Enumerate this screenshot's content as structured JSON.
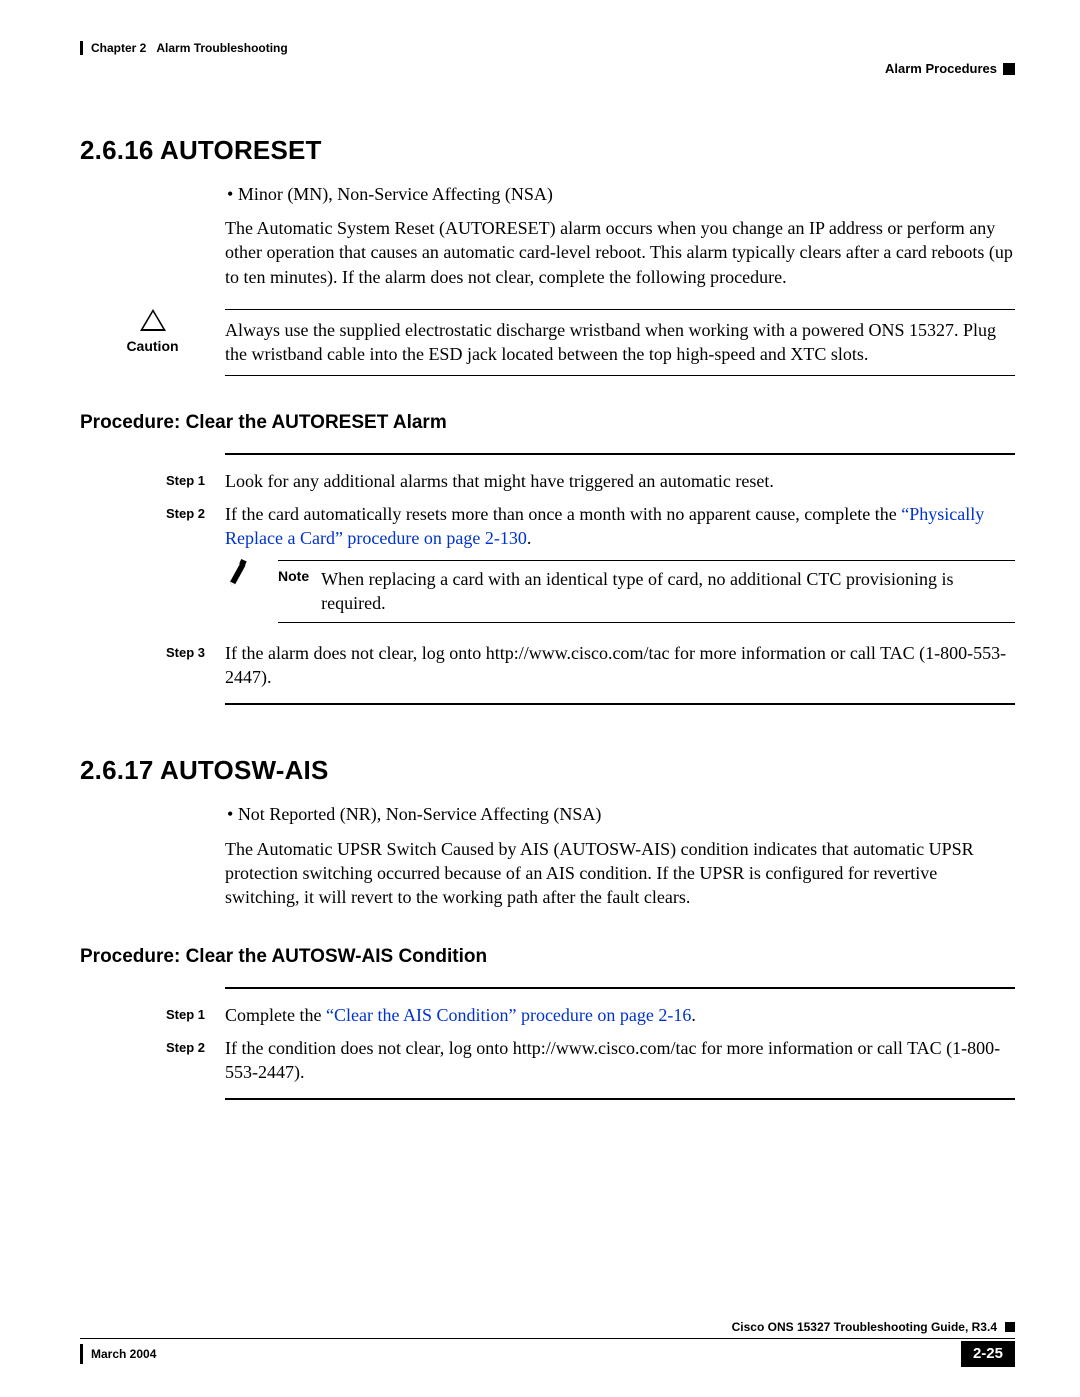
{
  "header": {
    "chapter": "Chapter 2",
    "title": "Alarm Troubleshooting",
    "section": "Alarm Procedures"
  },
  "sections": [
    {
      "number": "2.6.16",
      "title": "AUTORESET",
      "bullet": "Minor (MN), Non-Service Affecting (NSA)",
      "intro": "The Automatic System Reset (AUTORESET) alarm occurs when you change an IP address or perform any other operation that causes an automatic card-level reboot. This alarm typically clears after a card reboots (up to ten minutes). If the alarm does not clear, complete the following procedure.",
      "caution_label": "Caution",
      "caution": "Always use the supplied electrostatic discharge wristband when working with a powered ONS 15327. Plug the wristband cable into the ESD jack located between the top high-speed and XTC slots.",
      "procedure_title": "Procedure: Clear the AUTORESET Alarm",
      "steps": [
        {
          "label": "Step 1",
          "text": "Look for any additional alarms that might have triggered an automatic reset."
        },
        {
          "label": "Step 2",
          "text_before": "If the card automatically resets more than once a month with no apparent cause, complete the ",
          "link": "“Physically Replace a Card” procedure on page 2-130",
          "text_after": "."
        },
        {
          "label": "Step 3",
          "text": "If the alarm does not clear, log onto http://www.cisco.com/tac for more information or call TAC (1-800-553-2447)."
        }
      ],
      "note_label": "Note",
      "note": "When replacing a card with an identical type of card, no additional CTC provisioning is required."
    },
    {
      "number": "2.6.17",
      "title": "AUTOSW-AIS",
      "bullet": "Not Reported (NR), Non-Service Affecting (NSA)",
      "intro": "The Automatic UPSR Switch Caused by AIS (AUTOSW-AIS) condition indicates that automatic UPSR protection switching occurred because of an AIS condition. If the UPSR is configured for revertive switching, it will revert to the working path after the fault clears.",
      "procedure_title": "Procedure: Clear the AUTOSW-AIS Condition",
      "steps": [
        {
          "label": "Step 1",
          "text_before": "Complete the ",
          "link": "“Clear the AIS Condition” procedure on page 2-16",
          "text_after": "."
        },
        {
          "label": "Step 2",
          "text": "If the condition does not clear, log onto http://www.cisco.com/tac for more information or call TAC (1-800-553-2447)."
        }
      ]
    }
  ],
  "footer": {
    "guide": "Cisco ONS 15327 Troubleshooting Guide, R3.4",
    "date": "March 2004",
    "page": "2-25"
  }
}
